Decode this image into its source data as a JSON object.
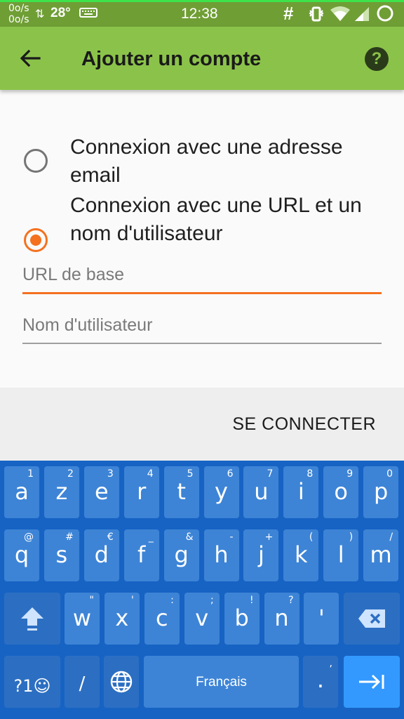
{
  "status_bar": {
    "rate_up": "0o/s",
    "rate_down": "0o/s",
    "temperature": "28°",
    "time": "12:38",
    "hash": "#"
  },
  "app_bar": {
    "title": "Ajouter un compte",
    "help_glyph": "?"
  },
  "options": [
    {
      "label": "Connexion avec une adresse email",
      "selected": false
    },
    {
      "label": "Connexion avec une URL et un nom d'utilisateur",
      "selected": true
    }
  ],
  "fields": {
    "base_url_placeholder": "URL de base",
    "username_placeholder": "Nom d'utilisateur"
  },
  "actions": {
    "connect_label": "SE CONNECTER"
  },
  "keyboard": {
    "row1": [
      {
        "k": "a",
        "h": "1"
      },
      {
        "k": "z",
        "h": "2"
      },
      {
        "k": "e",
        "h": "3"
      },
      {
        "k": "r",
        "h": "4"
      },
      {
        "k": "t",
        "h": "5"
      },
      {
        "k": "y",
        "h": "6"
      },
      {
        "k": "u",
        "h": "7"
      },
      {
        "k": "i",
        "h": "8"
      },
      {
        "k": "o",
        "h": "9"
      },
      {
        "k": "p",
        "h": "0"
      }
    ],
    "row2": [
      {
        "k": "q",
        "h": "@"
      },
      {
        "k": "s",
        "h": "#"
      },
      {
        "k": "d",
        "h": "€"
      },
      {
        "k": "f",
        "h": "_"
      },
      {
        "k": "g",
        "h": "&"
      },
      {
        "k": "h",
        "h": "-"
      },
      {
        "k": "j",
        "h": "+"
      },
      {
        "k": "k",
        "h": "("
      },
      {
        "k": "l",
        "h": ")"
      },
      {
        "k": "m",
        "h": "/"
      }
    ],
    "row3": [
      {
        "k": "w",
        "h": "\""
      },
      {
        "k": "x",
        "h": "'"
      },
      {
        "k": "c",
        "h": ":"
      },
      {
        "k": "v",
        "h": ";"
      },
      {
        "k": "b",
        "h": "!"
      },
      {
        "k": "n",
        "h": "?"
      },
      {
        "k": "'",
        "h": ""
      }
    ],
    "symbols_label": "?1☺",
    "slash_label": "/",
    "space_label": "Français",
    "period_label": ".",
    "period_hint": ","
  },
  "colors": {
    "accent": "#f4711f",
    "appbar": "#8bc34a",
    "statusbar": "#6f9e35",
    "keyboard": "#1763c4",
    "key": "#3d84d6"
  }
}
